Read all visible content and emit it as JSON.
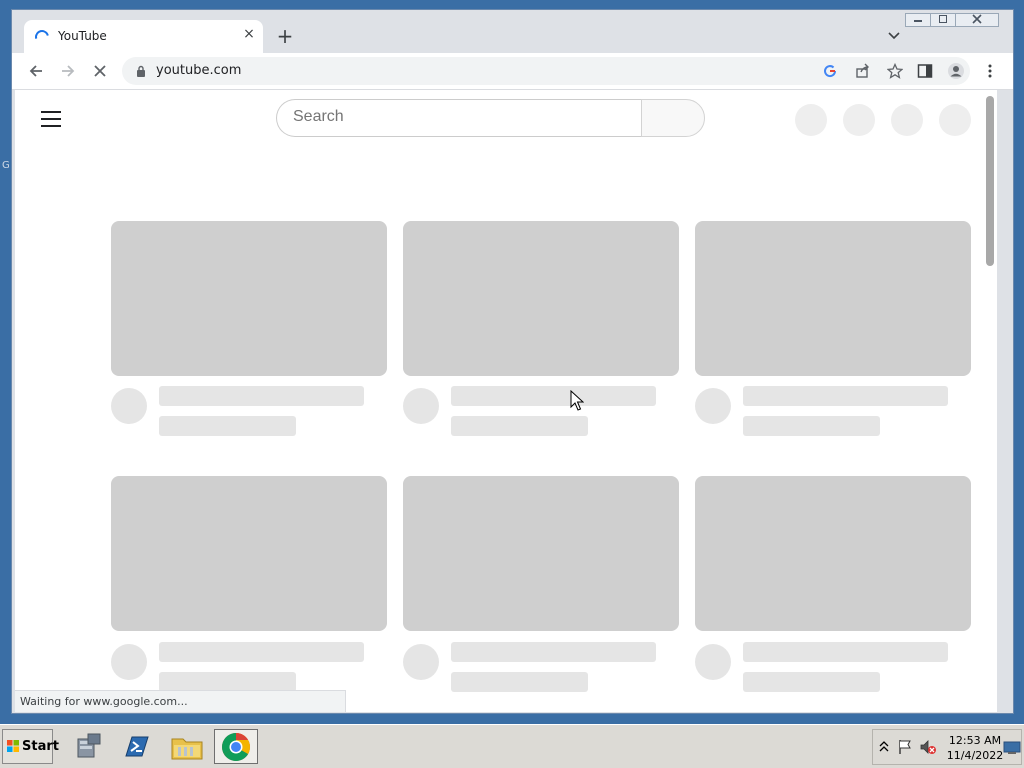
{
  "desktop": {
    "fragment_text": "G"
  },
  "browser": {
    "tab": {
      "title": "YouTube",
      "close_glyph": "×"
    },
    "new_tab_glyph": "+",
    "window_buttons": [
      "minimize",
      "restore",
      "close"
    ],
    "omnibox": {
      "url": "youtube.com"
    },
    "status_text": "Waiting for www.google.com..."
  },
  "youtube": {
    "search_placeholder": "Search",
    "video_rows": 2,
    "video_columns": 3
  },
  "taskbar": {
    "start_label": "Start",
    "apps": [
      "server-manager",
      "powershell",
      "file-explorer",
      "chrome"
    ],
    "clock_time": "12:53 AM",
    "clock_date": "11/4/2022"
  },
  "colors": {
    "accent": "#1a73e8",
    "skeleton": "#cfcfcf",
    "desktop": "#3a6ea5"
  }
}
